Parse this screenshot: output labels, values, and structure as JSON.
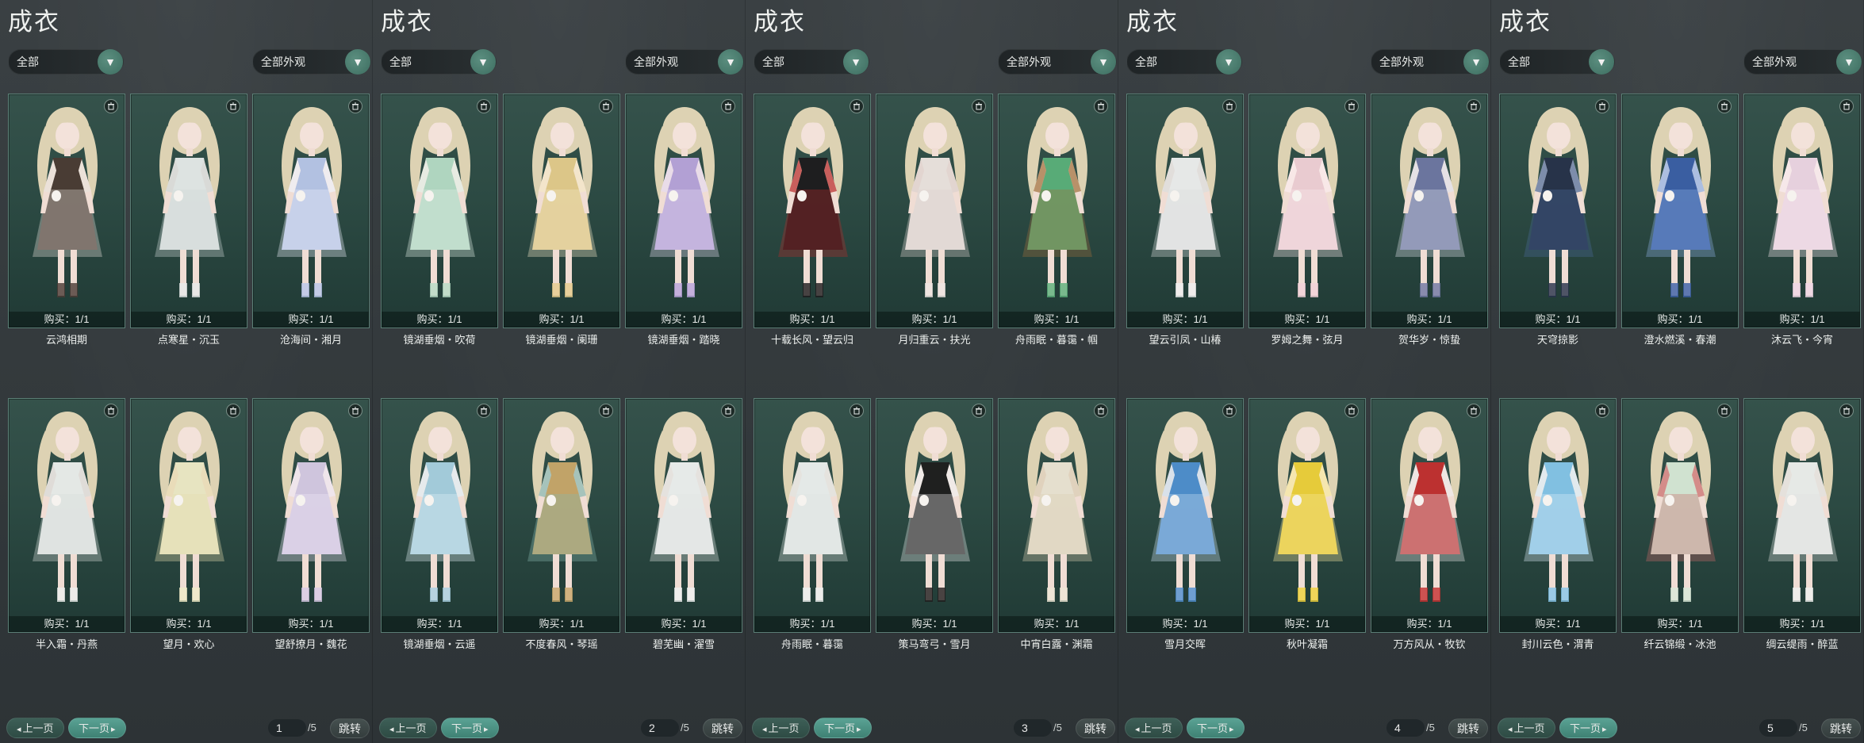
{
  "colors": {
    "card_bg": "#2c4a43",
    "card_border": "#5b7f76",
    "accent_next": "#3f8274",
    "hair": "#ddd2b3"
  },
  "icons": {
    "delete": "trash-icon",
    "dropdown": "chevron-down-icon"
  },
  "panels": [
    {
      "title": "成衣",
      "filter1": "全部",
      "filter2": "全部外观",
      "prev": "上一页",
      "next": "下一页",
      "page": "1",
      "total": "/5",
      "jump": "跳转",
      "items": [
        {
          "buy": "购买：1/1",
          "name": "云鸿相期",
          "outfit": "#4b3b34",
          "accent": "#e8e2dc"
        },
        {
          "buy": "购买：1/1",
          "name": "点寒星・沉玉",
          "outfit": "#e7ebea",
          "accent": "#cfd8d8"
        },
        {
          "buy": "购买：1/1",
          "name": "沧海间・湘月",
          "outfit": "#b9c7ea",
          "accent": "#eef2fb"
        },
        {
          "buy": "购买：1/1",
          "name": "半入霜・丹燕",
          "outfit": "#eef0ee",
          "accent": "#d7dcda"
        },
        {
          "buy": "购买：1/1",
          "name": "望月・欢心",
          "outfit": "#f1ecc8",
          "accent": "#e6dcae"
        },
        {
          "buy": "购买：1/1",
          "name": "望舒撩月・魏花",
          "outfit": "#d8cbe6",
          "accent": "#eee8f5"
        }
      ]
    },
    {
      "title": "成衣",
      "filter1": "全部",
      "filter2": "全部外观",
      "prev": "上一页",
      "next": "下一页",
      "page": "2",
      "total": "/5",
      "jump": "跳转",
      "items": [
        {
          "buy": "购买：1/1",
          "name": "镜湖垂烟・吹荷",
          "outfit": "#b6dcc6",
          "accent": "#e3f1e8"
        },
        {
          "buy": "购买：1/1",
          "name": "镜湖垂烟・阑珊",
          "outfit": "#e6cc8c",
          "accent": "#f3e8c8"
        },
        {
          "buy": "购买：1/1",
          "name": "镜湖垂烟・踏晓",
          "outfit": "#b9a4dc",
          "accent": "#e5dcf1"
        },
        {
          "buy": "购买：1/1",
          "name": "镜湖垂烟・云遥",
          "outfit": "#a9d1e2",
          "accent": "#e1f0f6"
        },
        {
          "buy": "购买：1/1",
          "name": "不度春风・琴瑶",
          "outfit": "#c9a86a",
          "accent": "#86b8b0"
        },
        {
          "buy": "购买：1/1",
          "name": "碧芜幽・濯雪",
          "outfit": "#f0f2f1",
          "accent": "#dfe4e3"
        }
      ]
    },
    {
      "title": "成衣",
      "filter1": "全部",
      "filter2": "全部外观",
      "prev": "上一页",
      "next": "下一页",
      "page": "3",
      "total": "/5",
      "jump": "跳转",
      "items": [
        {
          "buy": "购买：1/1",
          "name": "十载长风・望云归",
          "outfit": "#1d1b1d",
          "accent": "#b82a2a"
        },
        {
          "buy": "购买：1/1",
          "name": "月归重云・扶光",
          "outfit": "#efe6e2",
          "accent": "#dcd2cf"
        },
        {
          "buy": "购买：1/1",
          "name": "舟雨眠・暮霭・帼",
          "outfit": "#5bb07a",
          "accent": "#a0703c"
        },
        {
          "buy": "购买：1/1",
          "name": "舟雨眠・暮霭",
          "outfit": "#eef1f0",
          "accent": "#dfe5e3"
        },
        {
          "buy": "购买：1/1",
          "name": "策马弯弓・雪月",
          "outfit": "#1f1d1d",
          "accent": "#efefef"
        },
        {
          "buy": "购买：1/1",
          "name": "中宵白露・渊霜",
          "outfit": "#efe7d6",
          "accent": "#d9cdb3"
        }
      ]
    },
    {
      "title": "成衣",
      "filter1": "全部",
      "filter2": "全部外观",
      "prev": "上一页",
      "next": "下一页",
      "page": "4",
      "total": "/5",
      "jump": "跳转",
      "items": [
        {
          "buy": "购买：1/1",
          "name": "望云引凤・山椿",
          "outfit": "#f0f0f0",
          "accent": "#dadede"
        },
        {
          "buy": "购买：1/1",
          "name": "罗姆之舞・弦月",
          "outfit": "#f3d2d8",
          "accent": "#fbecef"
        },
        {
          "buy": "购买：1/1",
          "name": "贺华岁・惊蛰",
          "outfit": "#6f77a3",
          "accent": "#dfe2ec"
        },
        {
          "buy": "购买：1/1",
          "name": "雪月交晖",
          "outfit": "#4f8fd0",
          "accent": "#cfe2f4"
        },
        {
          "buy": "购买：1/1",
          "name": "秋叶凝霜",
          "outfit": "#f0d23a",
          "accent": "#f7e9a0"
        },
        {
          "buy": "购买：1/1",
          "name": "万方风从・牧钦",
          "outfit": "#c42f2f",
          "accent": "#eceaea"
        }
      ]
    },
    {
      "title": "成衣",
      "filter1": "全部",
      "filter2": "全部外观",
      "prev": "上一页",
      "next": "下一页",
      "page": "5",
      "total": "/5",
      "jump": "跳转",
      "items": [
        {
          "buy": "购买：1/1",
          "name": "天穹掠影",
          "outfit": "#27324a",
          "accent": "#4b6b9a"
        },
        {
          "buy": "购买：1/1",
          "name": "澄水燃溪・春潮",
          "outfit": "#3b5fa6",
          "accent": "#8fb1e6"
        },
        {
          "buy": "购买：1/1",
          "name": "沐云飞・今宵",
          "outfit": "#f0d7e6",
          "accent": "#f8ecf2"
        },
        {
          "buy": "购买：1/1",
          "name": "封川云色・渭青",
          "outfit": "#86c6ea",
          "accent": "#dceff9"
        },
        {
          "buy": "购买：1/1",
          "name": "纤云锦缎・冰池",
          "outfit": "#d9ead8",
          "accent": "#c86a6a"
        },
        {
          "buy": "购买：1/1",
          "name": "绸云缇雨・醉蓝",
          "outfit": "#f0f1ef",
          "accent": "#dfe3e0"
        }
      ]
    }
  ]
}
